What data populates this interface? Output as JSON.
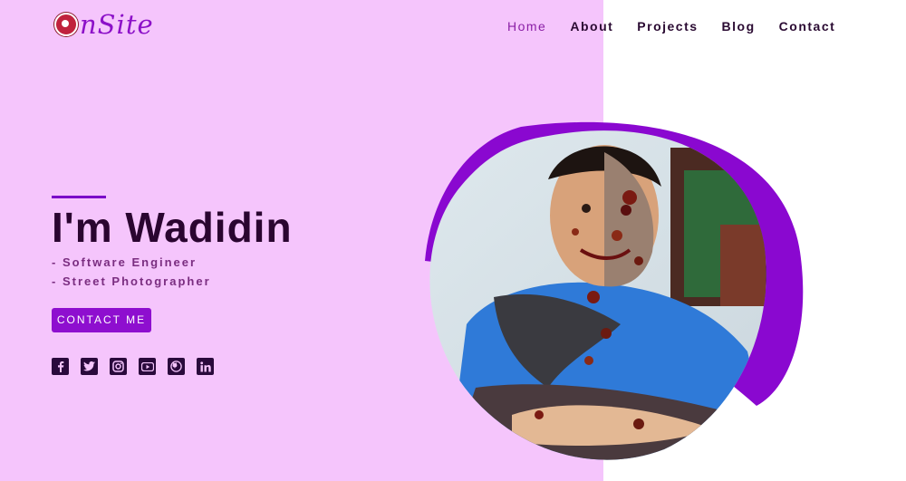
{
  "logo": {
    "text": "nSite"
  },
  "nav": {
    "items": [
      "Home",
      "About",
      "Projects",
      "Blog",
      "Contact"
    ]
  },
  "hero": {
    "title": "I'm Wadidin",
    "roles": [
      "- Software Engineer",
      "- Street Photographer"
    ],
    "cta_label": "CONTACT ME"
  },
  "social": {
    "icons": [
      "facebook-icon",
      "twitter-icon",
      "instagram-icon",
      "youtube-icon",
      "github-icon",
      "linkedin-icon"
    ]
  },
  "colors": {
    "accent": "#8e0fcf",
    "left_panel": "#f5c5fc",
    "title": "#2a0530",
    "blob": "#8a08d0"
  }
}
